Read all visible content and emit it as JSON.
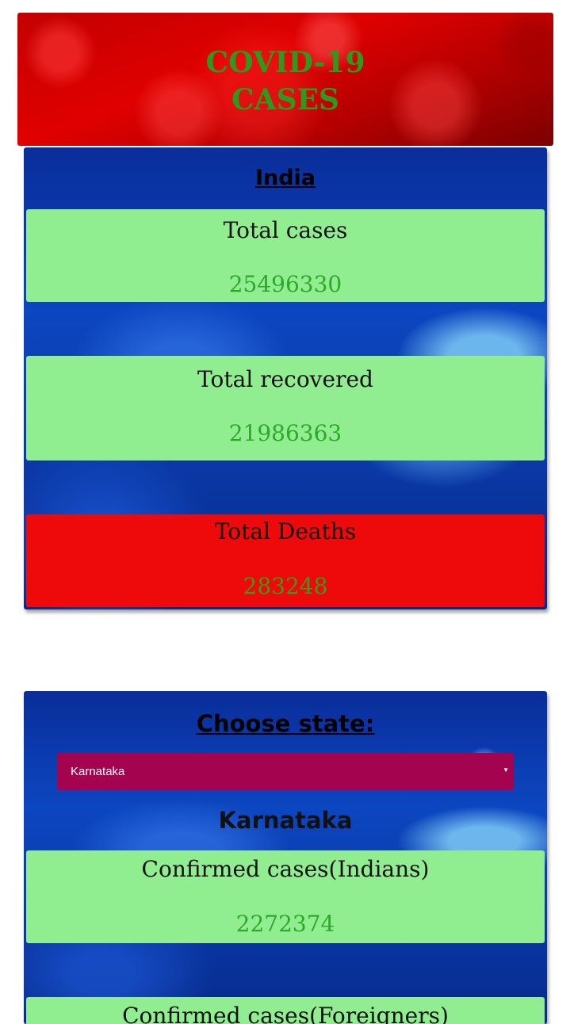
{
  "header": {
    "title_line1": "COVID-19",
    "title_line2": "CASES"
  },
  "india": {
    "heading": "India",
    "cards": [
      {
        "label": "Total cases",
        "value": "25496330"
      },
      {
        "label": "Total recovered",
        "value": "21986363"
      },
      {
        "label": "Total Deaths",
        "value": "283248"
      }
    ]
  },
  "state_section": {
    "heading": "Choose state:",
    "select": {
      "selected": "Karnataka"
    },
    "state_name": "Karnataka",
    "cards": [
      {
        "label": "Confirmed cases(Indians)",
        "value": "2272374"
      },
      {
        "label": "Confirmed cases(Foreigners)"
      }
    ]
  },
  "colors": {
    "title_green": "#2d9a1e",
    "card_green": "#90ee90",
    "card_red": "#ee0a0a",
    "select_bg": "#a3034f"
  }
}
